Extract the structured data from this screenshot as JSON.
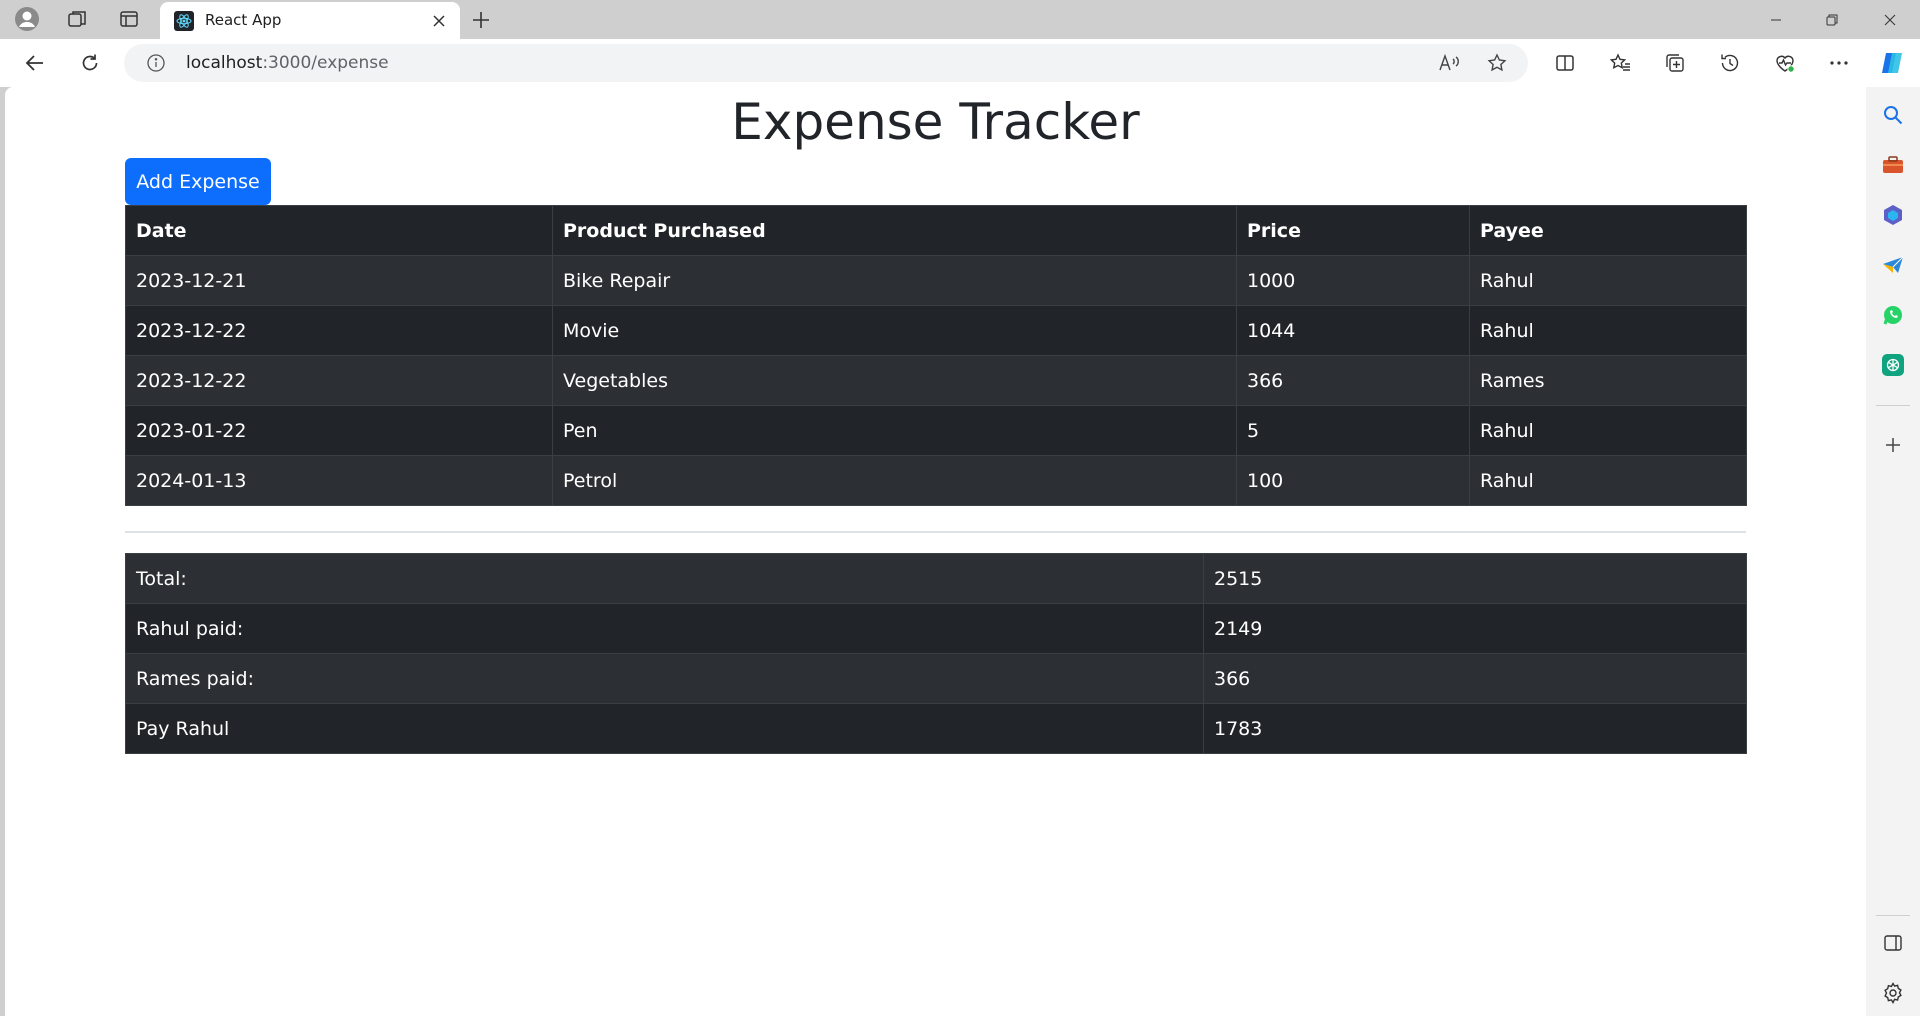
{
  "browser": {
    "tab_title": "React App",
    "url_host": "localhost",
    "url_path": ":3000/expense"
  },
  "page": {
    "title": "Expense Tracker",
    "add_button": "Add Expense"
  },
  "expenses": {
    "headers": [
      "Date",
      "Product Purchased",
      "Price",
      "Payee"
    ],
    "rows": [
      {
        "date": "2023-12-21",
        "product": "Bike Repair",
        "price": "1000",
        "payee": "Rahul"
      },
      {
        "date": "2023-12-22",
        "product": "Movie",
        "price": "1044",
        "payee": "Rahul"
      },
      {
        "date": "2023-12-22",
        "product": "Vegetables",
        "price": "366",
        "payee": "Rames"
      },
      {
        "date": "2023-01-22",
        "product": "Pen",
        "price": "5",
        "payee": "Rahul"
      },
      {
        "date": "2024-01-13",
        "product": "Petrol",
        "price": "100",
        "payee": "Rahul"
      }
    ]
  },
  "summary": {
    "rows": [
      {
        "label": "Total:",
        "value": "2515"
      },
      {
        "label": "Rahul paid:",
        "value": "2149"
      },
      {
        "label": "Rames paid:",
        "value": "366"
      },
      {
        "label": "Pay Rahul",
        "value": "1783"
      }
    ]
  },
  "colors": {
    "accent": "#0d6efd",
    "table_dark": "#212529",
    "table_stripe": "#2c3034"
  }
}
